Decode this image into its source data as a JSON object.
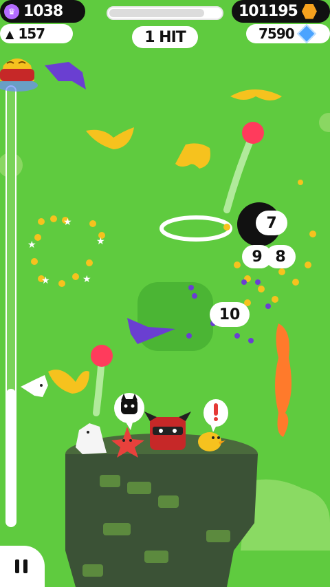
{
  "hud": {
    "coins": "1038",
    "level": "157",
    "hits_label": "1 HIT",
    "score": "101195",
    "gems": "7590",
    "progress": 0.85
  },
  "combo": {
    "bubble_7": "7",
    "bubble_9": "9",
    "bubble_8": "8",
    "bubble_10": "10"
  },
  "side_meter": {
    "fill_fraction": 0.3
  },
  "colors": {
    "background": "#5fcb3f",
    "coin": "#f6c21e",
    "gem": "#4aa3ff",
    "ball": "#ff3b5c"
  },
  "icons": [
    "pause-icon",
    "gem-icon",
    "coin-hex-icon",
    "triangle-level-icon",
    "crown-icon"
  ]
}
